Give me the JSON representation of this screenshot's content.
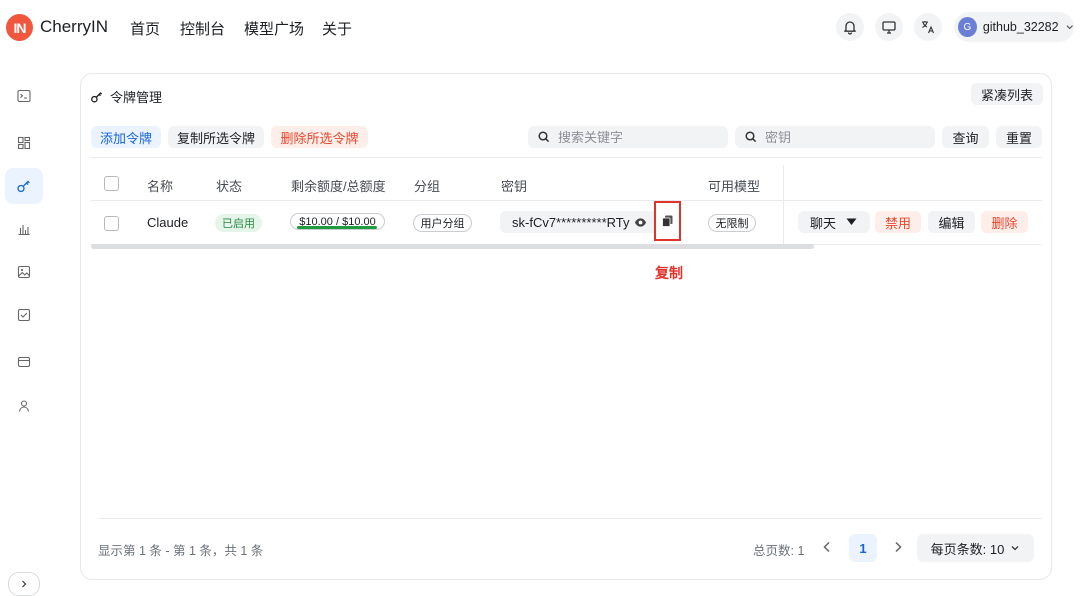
{
  "header": {
    "logo_text": "IN",
    "brand": "CherryIN",
    "nav": [
      "首页",
      "控制台",
      "模型广场",
      "关于"
    ],
    "user_initial": "G",
    "user_name": "github_32282"
  },
  "page": {
    "title": "令牌管理",
    "compact_toggle": "紧凑列表"
  },
  "toolbar": {
    "add_label": "添加令牌",
    "copy_selected_label": "复制所选令牌",
    "delete_selected_label": "删除所选令牌",
    "keyword_placeholder": "搜索关键字",
    "key_placeholder": "密钥",
    "query_label": "查询",
    "reset_label": "重置"
  },
  "table": {
    "columns": [
      "名称",
      "状态",
      "剩余额度/总额度",
      "分组",
      "密钥",
      "可用模型"
    ],
    "rows": [
      {
        "name": "Claude",
        "status": "已启用",
        "quota": "$10.00 / $10.00",
        "quota_fraction": 1.0,
        "group": "用户分组",
        "key": "sk-fCv7**********RTy",
        "models": "无限制",
        "actions": {
          "chat": "聊天",
          "disable": "禁用",
          "edit": "编辑",
          "delete": "删除"
        }
      }
    ]
  },
  "annotation": {
    "label": "复制",
    "color": "#e0332c"
  },
  "footer": {
    "summary": "显示第 1 条 - 第 1 条，共 1 条",
    "total_pages": "总页数: 1",
    "current_page": "1",
    "page_size": "每页条数: 10"
  },
  "colors": {
    "accent": "#1665d8",
    "danger": "#e9462d",
    "brand": "#f0573c",
    "success": "#2a8a45"
  },
  "icons": [
    "terminal-icon",
    "dashboard-grid-icon",
    "key-icon",
    "bar-chart-icon",
    "image-icon",
    "task-check-icon",
    "wallet-card-icon",
    "user-icon",
    "bell-icon",
    "monitor-icon",
    "translate-icon",
    "chevron-down-icon",
    "search-icon",
    "eye-icon",
    "copy-icon",
    "chevron-left-icon",
    "chevron-right-icon",
    "chevron-expand-icon"
  ]
}
